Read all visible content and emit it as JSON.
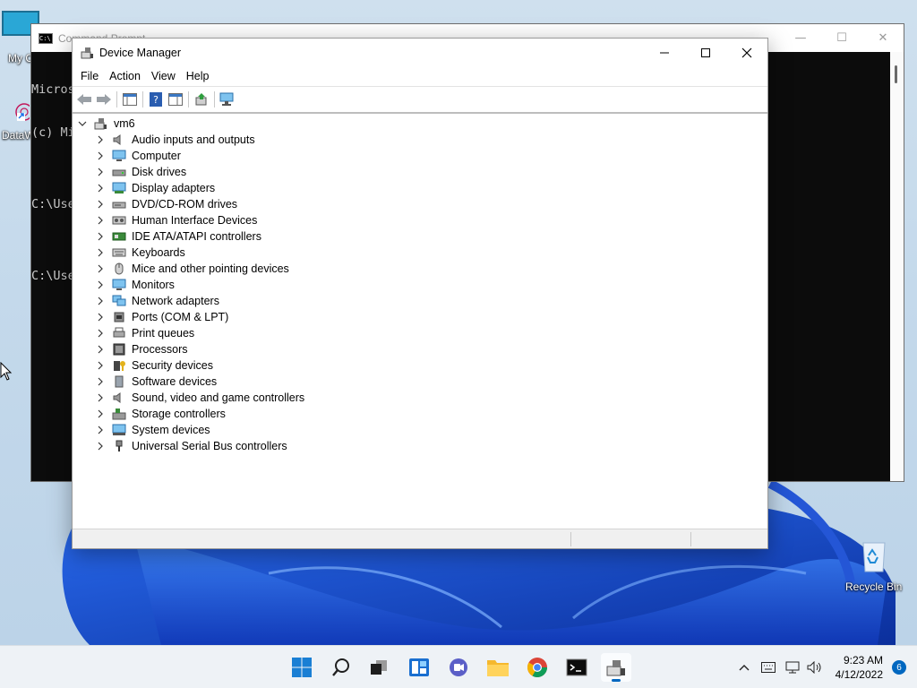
{
  "desktop": {
    "icons": [
      {
        "label": "My C",
        "icon": "computer-icon"
      },
      {
        "label": "DataW",
        "icon": "datawarrior-shortcut-icon"
      },
      {
        "label": "Recycle Bin",
        "icon": "recycle-bin-icon"
      }
    ]
  },
  "cmd": {
    "title": "Command Prompt",
    "lines": [
      "Micros",
      "(c) Mi",
      "",
      "C:\\Use",
      "",
      "C:\\Use"
    ]
  },
  "device_manager": {
    "title": "Device Manager",
    "menu": [
      "File",
      "Action",
      "View",
      "Help"
    ],
    "toolbar": [
      "back-arrow-icon",
      "forward-arrow-icon",
      "show-hide-console-tree-icon",
      "help-icon",
      "properties-icon",
      "update-driver-icon",
      "scan-hardware-changes-icon"
    ],
    "root": {
      "label": "vm6",
      "expanded": true
    },
    "categories": [
      {
        "label": "Audio inputs and outputs",
        "icon": "speaker-icon"
      },
      {
        "label": "Computer",
        "icon": "monitor-icon"
      },
      {
        "label": "Disk drives",
        "icon": "disk-drive-icon"
      },
      {
        "label": "Display adapters",
        "icon": "display-adapter-icon"
      },
      {
        "label": "DVD/CD-ROM drives",
        "icon": "dvd-drive-icon"
      },
      {
        "label": "Human Interface Devices",
        "icon": "hid-icon"
      },
      {
        "label": "IDE ATA/ATAPI controllers",
        "icon": "ide-controller-icon"
      },
      {
        "label": "Keyboards",
        "icon": "keyboard-icon"
      },
      {
        "label": "Mice and other pointing devices",
        "icon": "mouse-icon"
      },
      {
        "label": "Monitors",
        "icon": "monitor-icon"
      },
      {
        "label": "Network adapters",
        "icon": "network-adapter-icon"
      },
      {
        "label": "Ports (COM & LPT)",
        "icon": "port-icon"
      },
      {
        "label": "Print queues",
        "icon": "printer-icon"
      },
      {
        "label": "Processors",
        "icon": "processor-icon"
      },
      {
        "label": "Security devices",
        "icon": "security-device-icon"
      },
      {
        "label": "Software devices",
        "icon": "software-device-icon"
      },
      {
        "label": "Sound, video and game controllers",
        "icon": "speaker-icon"
      },
      {
        "label": "Storage controllers",
        "icon": "storage-controller-icon"
      },
      {
        "label": "System devices",
        "icon": "system-device-icon"
      },
      {
        "label": "Universal Serial Bus controllers",
        "icon": "usb-icon"
      }
    ]
  },
  "taskbar": {
    "apps": [
      "start-icon",
      "search-icon",
      "task-view-icon",
      "widgets-icon",
      "teams-chat-icon",
      "file-explorer-icon",
      "chrome-icon",
      "command-prompt-icon",
      "device-manager-icon"
    ],
    "active_app": "device-manager-icon",
    "tray_icons": [
      "chevron-up-icon",
      "keyboard-icon",
      "network-icon",
      "volume-icon"
    ],
    "time": "9:23 AM",
    "date": "4/12/2022",
    "notification_count": "6"
  },
  "colors": {
    "accent": "#0067c0",
    "cmd_bg": "#0c0c0c",
    "wallpaper_blue": "#1f56d9"
  }
}
